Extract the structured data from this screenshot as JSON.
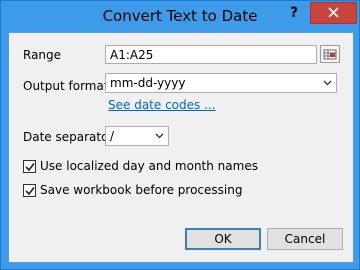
{
  "window": {
    "title": "Convert Text to Date",
    "help_glyph": "?"
  },
  "form": {
    "range_label": "Range",
    "range_value": "A1:A25",
    "output_format_label": "Output format",
    "output_format_value": "mm-dd-yyyy",
    "date_codes_link": "See date codes ...",
    "date_separator_label": "Date separator",
    "date_separator_value": "/",
    "use_localized_label": "Use localized day and month names",
    "use_localized_checked": true,
    "save_workbook_label": "Save workbook before processing",
    "save_workbook_checked": true
  },
  "buttons": {
    "ok": "OK",
    "cancel": "Cancel"
  },
  "colors": {
    "titlebar": "#3d9be9",
    "close": "#c7453d",
    "link": "#0066cc",
    "client": "#f0f0f0"
  },
  "icons": {
    "close": "close-icon",
    "range_picker": "range-select-icon",
    "dropdown": "chevron-down-icon",
    "check": "check-icon"
  }
}
